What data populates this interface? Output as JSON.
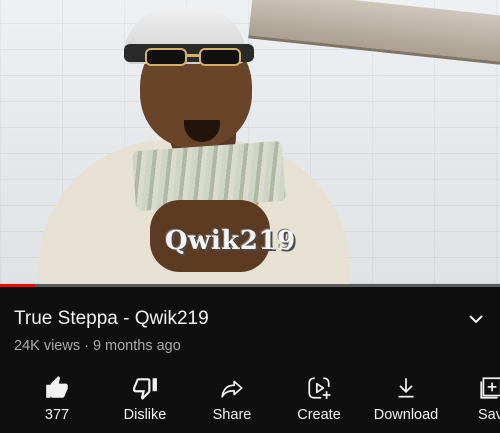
{
  "video": {
    "watermark": "Qwik219",
    "progress": 0.07
  },
  "info": {
    "title": "True Steppa - Qwik219",
    "views": "24K views",
    "separator": "·",
    "age": "9 months ago"
  },
  "actions": [
    {
      "label": "377",
      "icon": "thumbs-up-icon"
    },
    {
      "label": "Dislike",
      "icon": "thumbs-down-icon"
    },
    {
      "label": "Share",
      "icon": "share-icon"
    },
    {
      "label": "Create",
      "icon": "create-icon"
    },
    {
      "label": "Download",
      "icon": "download-icon"
    },
    {
      "label": "Sav",
      "icon": "save-icon"
    }
  ],
  "colors": {
    "background": "#0f0f0f",
    "text": "#f1f1f1",
    "secondary_text": "#aaaaaa",
    "progress": "#ff0000"
  }
}
